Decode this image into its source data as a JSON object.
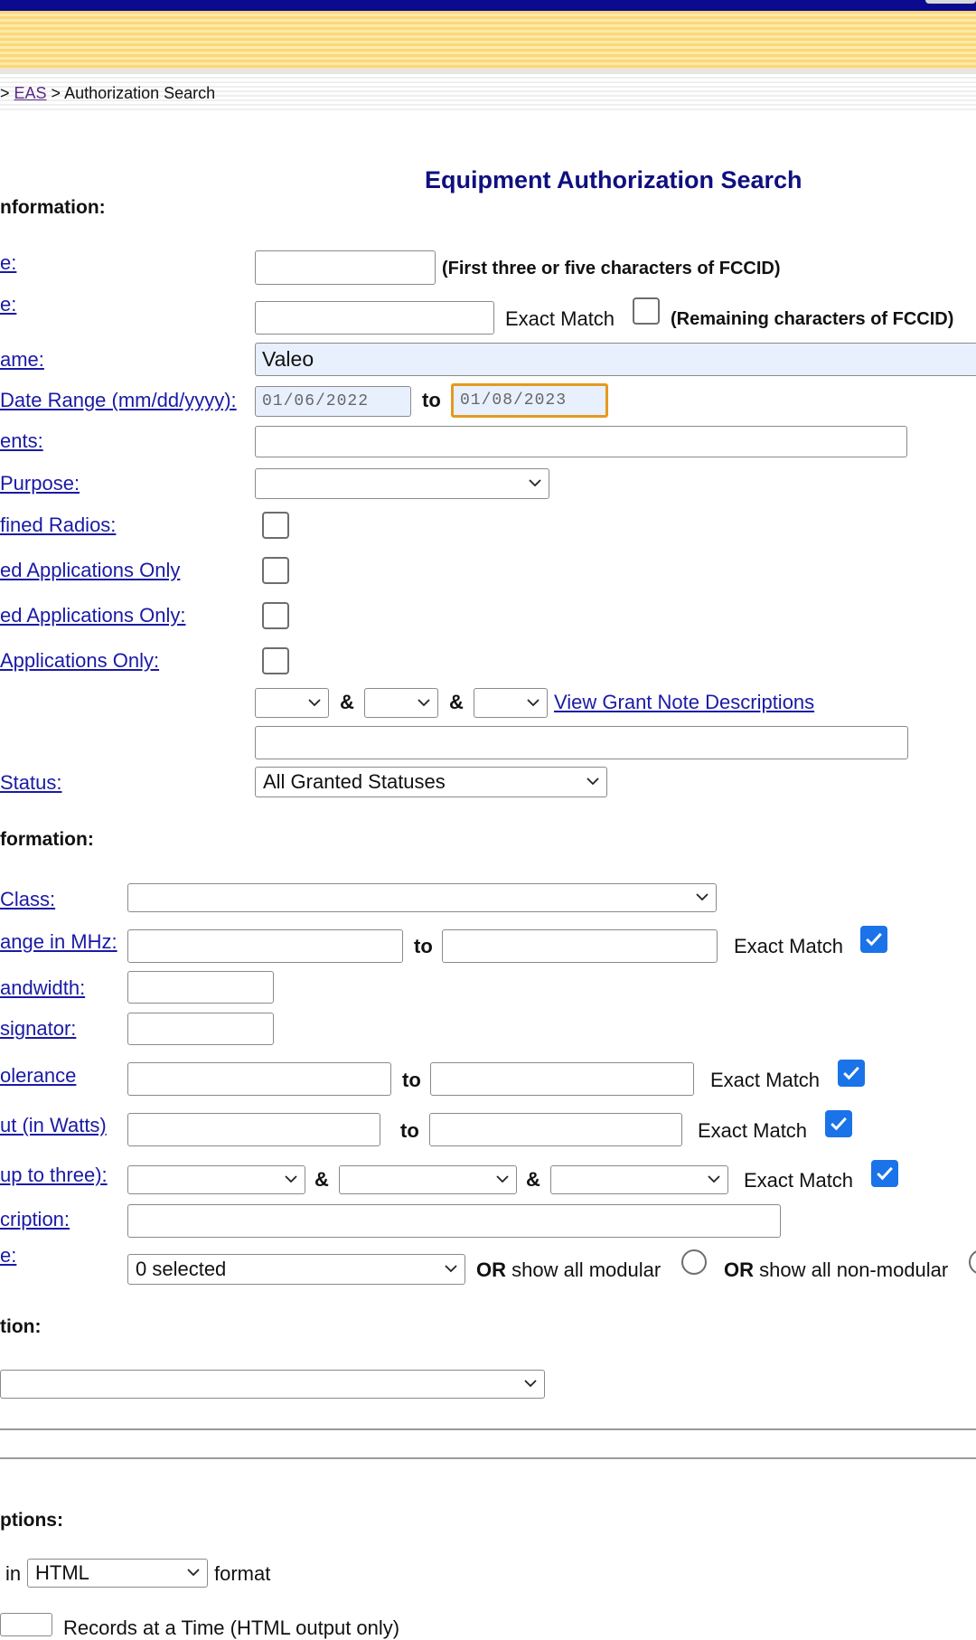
{
  "breadcrumb": {
    "sep1": " > ",
    "eas": "EAS",
    "sep2": " > ",
    "current": "Authorization Search"
  },
  "title": "Equipment Authorization Search",
  "section_app_info": "nformation:",
  "fields": {
    "grantee_code": {
      "label": "e:",
      "value": "",
      "hint": "(First three or five characters of FCCID)"
    },
    "product_code": {
      "label": "e:",
      "value": "",
      "exact_label": "Exact Match",
      "exact_checked": false,
      "hint": "(Remaining characters of FCCID)"
    },
    "applicant_name": {
      "label": "ame:",
      "value": "Valeo"
    },
    "date_range": {
      "label": "Date Range (mm/dd/yyyy):",
      "from": "01/06/2022",
      "to_label": "to",
      "to": "01/08/2023"
    },
    "comments": {
      "label": "ents:",
      "value": ""
    },
    "purpose": {
      "label": "Purpose:",
      "value": ""
    },
    "software_defined": {
      "label": "fined Radios:",
      "checked": false
    },
    "apps_only_1": {
      "label": "ed Applications Only",
      "checked": false
    },
    "apps_only_2": {
      "label": "ed Applications Only:",
      "checked": false
    },
    "apps_only_3": {
      "label": "Applications Only:",
      "checked": false
    },
    "grant_notes": {
      "amp1": "&",
      "amp2": "&",
      "link": "View Grant Note Descriptions",
      "text_value": ""
    },
    "status": {
      "label": "Status:",
      "value": "All Granted Statuses"
    }
  },
  "section_equip_info": "formation:",
  "equip": {
    "class": {
      "label": "Class:",
      "value": ""
    },
    "freq_range": {
      "label": "ange in MHz:",
      "to_label": "to",
      "exact_label": "Exact Match",
      "exact_checked": true
    },
    "bandwidth": {
      "label": "andwidth:"
    },
    "emission": {
      "label": "signator:"
    },
    "tolerance": {
      "label": "olerance",
      "to_label": "to",
      "exact_label": "Exact Match",
      "exact_checked": true
    },
    "output": {
      "label": "ut (in Watts)",
      "to_label": "to",
      "exact_label": "Exact Match",
      "exact_checked": true
    },
    "rule_parts": {
      "label": "up to three):",
      "amp1": "&",
      "amp2": "&",
      "exact_label": "Exact Match",
      "exact_checked": true
    },
    "description": {
      "label": "cription:"
    },
    "modular": {
      "label": "e:",
      "value": "0 selected",
      "or1": "OR",
      "show_modular": "show all modular",
      "or2": "OR",
      "show_nonmodular": "show all non-modular"
    }
  },
  "section_location": "tion:",
  "section_options": "ptions:",
  "options": {
    "format_prefix": "in",
    "format_value": "HTML",
    "format_suffix": "format",
    "records_label": "Records at a Time (HTML output only)"
  }
}
